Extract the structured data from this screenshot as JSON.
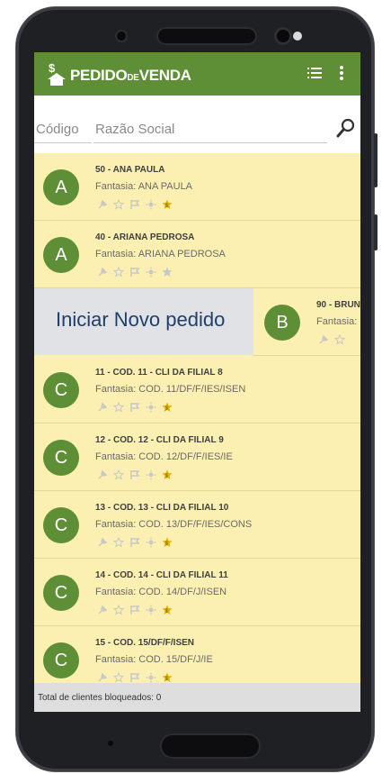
{
  "app": {
    "title_pedido": "PEDIDO",
    "title_de": "DE",
    "title_venda": "VENDA"
  },
  "search": {
    "code_placeholder": "Código",
    "name_placeholder": "Razão Social"
  },
  "clients": [
    {
      "initial": "A",
      "title": "50 - ANA PAULA",
      "fantasia": "Fantasia: ANA PAULA",
      "star_active": true
    },
    {
      "initial": "A",
      "title": "40 - ARIANA PEDROSA",
      "fantasia": "Fantasia: ARIANA PEDROSA",
      "star_active": false
    },
    {
      "initial": "B",
      "title": "90 - BRUN",
      "fantasia": "Fantasia: I",
      "star_active": false
    },
    {
      "initial": "C",
      "title": "11 - COD. 11 - CLI DA FILIAL 8",
      "fantasia": "Fantasia: COD. 11/DF/F/IES/ISEN",
      "star_active": true
    },
    {
      "initial": "C",
      "title": "12 - COD. 12 - CLI DA FILIAL 9",
      "fantasia": "Fantasia: COD. 12/DF/F/IES/IE",
      "star_active": true
    },
    {
      "initial": "C",
      "title": "13 - COD. 13 - CLI DA FILIAL 10",
      "fantasia": "Fantasia: COD. 13/DF/F/IES/CONS",
      "star_active": true
    },
    {
      "initial": "C",
      "title": "14 - COD. 14 - CLI DA FILIAL 11",
      "fantasia": "Fantasia: COD. 14/DF/J/ISEN",
      "star_active": true
    },
    {
      "initial": "C",
      "title": "15 - COD. 15/DF/F/ISEN",
      "fantasia": "Fantasia: COD. 15/DF/J/IE",
      "star_active": true
    }
  ],
  "swipe_action_label": "Iniciar Novo pedido",
  "footer": {
    "text": "Total de clientes bloqueados: 0"
  },
  "colors": {
    "appbar": "#5e8f37",
    "avatar": "#5e8f37",
    "row_bg": "#fbf0b2",
    "swipe_bg": "#e1e2e6",
    "swipe_text": "#1f3f6a",
    "star_active": "#e0b400"
  }
}
